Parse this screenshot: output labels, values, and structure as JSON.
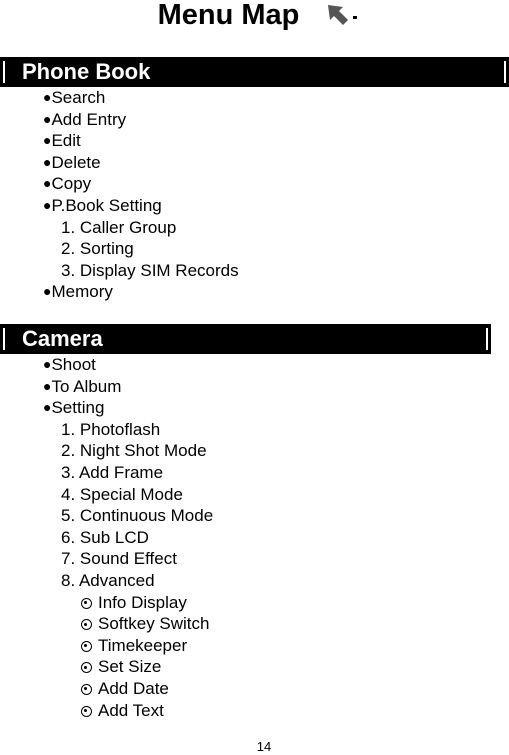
{
  "title": "Menu Map",
  "title_icon": "cursor-arrow-icon",
  "sections": [
    {
      "label": "Phone Book",
      "items": [
        {
          "level": 1,
          "marker": "●",
          "text": "Search"
        },
        {
          "level": 1,
          "marker": "●",
          "text": "Add Entry"
        },
        {
          "level": 1,
          "marker": "●",
          "text": "Edit"
        },
        {
          "level": 1,
          "marker": "●",
          "text": "Delete"
        },
        {
          "level": 1,
          "marker": "●",
          "text": "Copy"
        },
        {
          "level": 1,
          "marker": "●",
          "text": "P.Book Setting"
        },
        {
          "level": 2,
          "marker": "",
          "text": "1. Caller Group"
        },
        {
          "level": 2,
          "marker": "",
          "text": "2. Sorting"
        },
        {
          "level": 2,
          "marker": "",
          "text": "3. Display SIM Records"
        },
        {
          "level": 1,
          "marker": "●",
          "text": "Memory"
        }
      ]
    },
    {
      "label": "Camera",
      "items": [
        {
          "level": 1,
          "marker": "●",
          "text": "Shoot"
        },
        {
          "level": 1,
          "marker": "●",
          "text": "To Album"
        },
        {
          "level": 1,
          "marker": "●",
          "text": "Setting"
        },
        {
          "level": 2,
          "marker": "",
          "text": "1. Photoflash"
        },
        {
          "level": 2,
          "marker": "",
          "text": "2. Night Shot Mode"
        },
        {
          "level": 2,
          "marker": "",
          "text": "3. Add Frame"
        },
        {
          "level": 2,
          "marker": "",
          "text": "4. Special Mode"
        },
        {
          "level": 2,
          "marker": "",
          "text": "5. Continuous Mode"
        },
        {
          "level": 2,
          "marker": "",
          "text": "6. Sub LCD"
        },
        {
          "level": 2,
          "marker": "",
          "text": "7. Sound Effect"
        },
        {
          "level": 2,
          "marker": "",
          "text": "8. Advanced"
        },
        {
          "level": 3,
          "marker": "radio",
          "text": "Info Display"
        },
        {
          "level": 3,
          "marker": "radio",
          "text": "Softkey Switch"
        },
        {
          "level": 3,
          "marker": "radio",
          "text": "Timekeeper"
        },
        {
          "level": 3,
          "marker": "radio",
          "text": "Set Size"
        },
        {
          "level": 3,
          "marker": "radio",
          "text": "Add Date"
        },
        {
          "level": 3,
          "marker": "radio",
          "text": "Add Text"
        }
      ]
    }
  ],
  "page_number": "14",
  "colors": {
    "bar_background": "#000000",
    "bar_text": "#ffffff",
    "icon_gray": "#555555"
  }
}
